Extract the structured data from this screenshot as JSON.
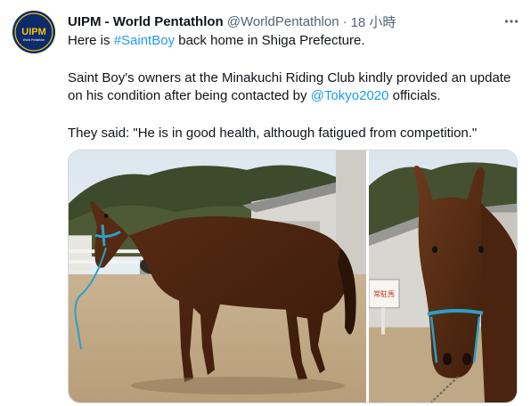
{
  "tweet": {
    "display_name": "UIPM - World Pentathlon",
    "handle": "@WorldPentathlon",
    "separator": "·",
    "time": "18 小時",
    "avatar": {
      "logo_text": "UIPM",
      "sub_text": "World Pentathlon",
      "bg_color": "#0d2a6b",
      "accent_color": "#f5c400"
    },
    "more_icon": "more-horizontal-icon",
    "text": {
      "line1_pre": "Here is ",
      "hashtag": "#SaintBoy",
      "line1_post": " back home in Shiga Prefecture.",
      "line2": "Saint Boy's owners at the Minakuchi Riding Club kindly provided an update",
      "line3_pre": "on his condition after being contacted by ",
      "mention": "@Tokyo2020",
      "line3_post": " officials.",
      "line4": "They said: \"He is in good health, although fatigued from competition.\""
    },
    "media": {
      "sign_text": "常駐馬",
      "photos": [
        "horse-photo-full-body",
        "horse-photo-head-closeup"
      ]
    },
    "colors": {
      "link": "#1d9bf0",
      "text": "#0f1419",
      "secondary": "#536471"
    }
  }
}
